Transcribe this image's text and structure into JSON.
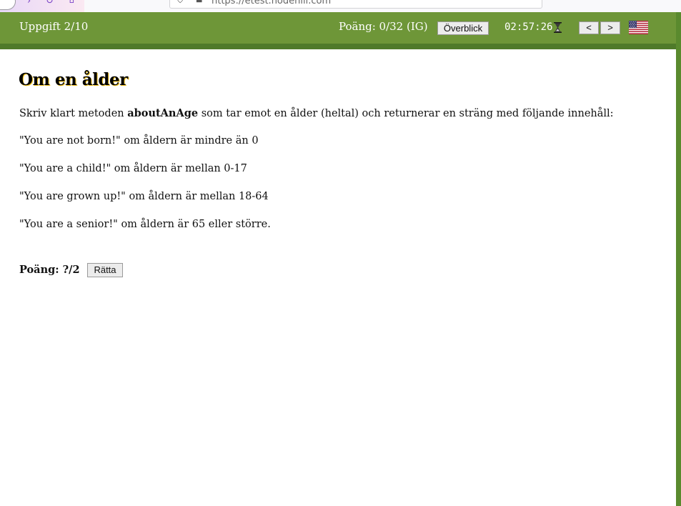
{
  "browser": {
    "url": "https://etest.nodehill.com"
  },
  "header": {
    "task_counter": "Uppgift 2/10",
    "score": "Poäng: 0/32 (IG)",
    "overview_label": "Överblick",
    "timer": "02:57:26",
    "prev_label": "<",
    "next_label": ">",
    "language_flag": "us-flag-icon"
  },
  "task": {
    "title": "Om en ålder",
    "intro_before": "Skriv klart metoden ",
    "method_name": "aboutAnAge",
    "intro_after": " som tar emot en ålder (heltal) och returnerar en sträng med följande innehåll:",
    "cases": [
      "\"You are not born!\" om åldern är mindre än 0",
      "\"You are a child!\" om åldern är mellan 0-17",
      "\"You are grown up!\" om åldern är mellan 18-64",
      "\"You are a senior!\" om åldern är 65 eller större."
    ],
    "points": "Poäng: ?/2",
    "check_label": "Rätta"
  },
  "colors": {
    "header_green": "#6e9638",
    "header_dark_green": "#4f7a2a",
    "title_shadow": "#f3c21a"
  }
}
